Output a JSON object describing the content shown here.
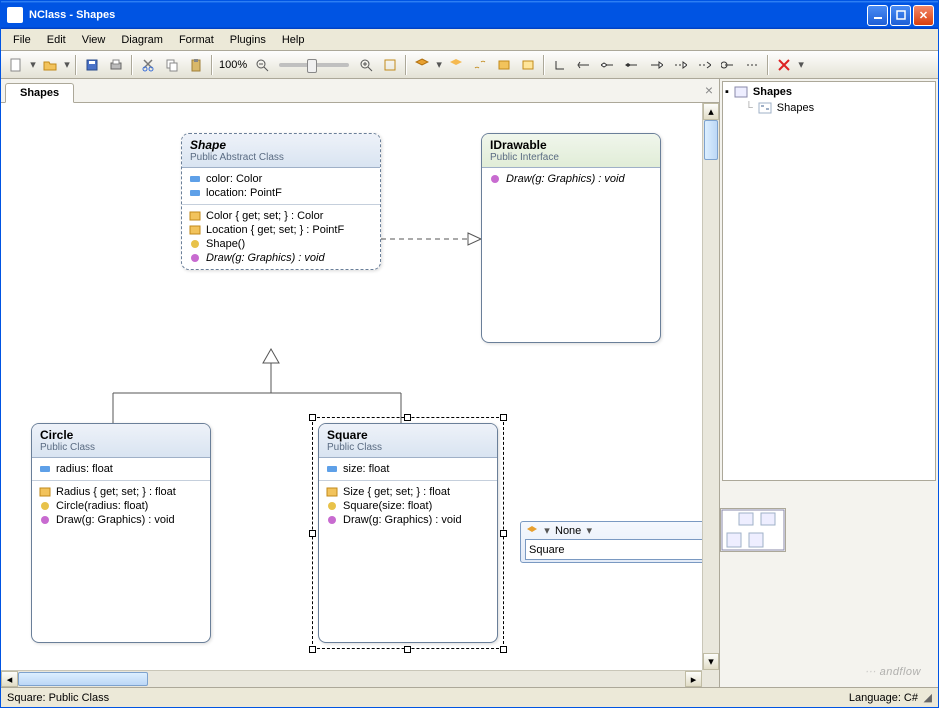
{
  "window": {
    "title": "NClass - Shapes"
  },
  "menu": {
    "file": "File",
    "edit": "Edit",
    "view": "View",
    "diagram": "Diagram",
    "format": "Format",
    "plugins": "Plugins",
    "help": "Help"
  },
  "toolbar": {
    "zoom_text": "100%"
  },
  "tabs": {
    "active": "Shapes"
  },
  "tree": {
    "root": "Shapes",
    "child": "Shapes"
  },
  "popup": {
    "access": "None",
    "input_value": "Square"
  },
  "status": {
    "left": "Square: Public Class",
    "right": "Language: C#"
  },
  "watermark": "andflow",
  "shape": {
    "name": "Shape",
    "stereotype": "Public Abstract Class",
    "fields": [
      "color: Color",
      "location: PointF"
    ],
    "members": [
      {
        "kind": "prop",
        "text": "Color { get; set; } : Color"
      },
      {
        "kind": "prop",
        "text": "Location { get; set; } : PointF"
      },
      {
        "kind": "ctor",
        "text": "Shape()"
      },
      {
        "kind": "method",
        "text": "Draw(g: Graphics) : void",
        "italic": true
      }
    ]
  },
  "idrawable": {
    "name": "IDrawable",
    "stereotype": "Public Interface",
    "members": [
      {
        "kind": "method",
        "text": "Draw(g: Graphics) : void",
        "italic": true
      }
    ]
  },
  "circle": {
    "name": "Circle",
    "stereotype": "Public Class",
    "fields": [
      "radius: float"
    ],
    "members": [
      {
        "kind": "prop",
        "text": "Radius { get; set; } : float"
      },
      {
        "kind": "ctor",
        "text": "Circle(radius: float)"
      },
      {
        "kind": "method",
        "text": "Draw(g: Graphics) : void"
      }
    ]
  },
  "square": {
    "name": "Square",
    "stereotype": "Public Class",
    "fields": [
      "size: float"
    ],
    "members": [
      {
        "kind": "prop",
        "text": "Size { get; set; } : float"
      },
      {
        "kind": "ctor",
        "text": "Square(size: float)"
      },
      {
        "kind": "method",
        "text": "Draw(g: Graphics) : void"
      }
    ]
  }
}
